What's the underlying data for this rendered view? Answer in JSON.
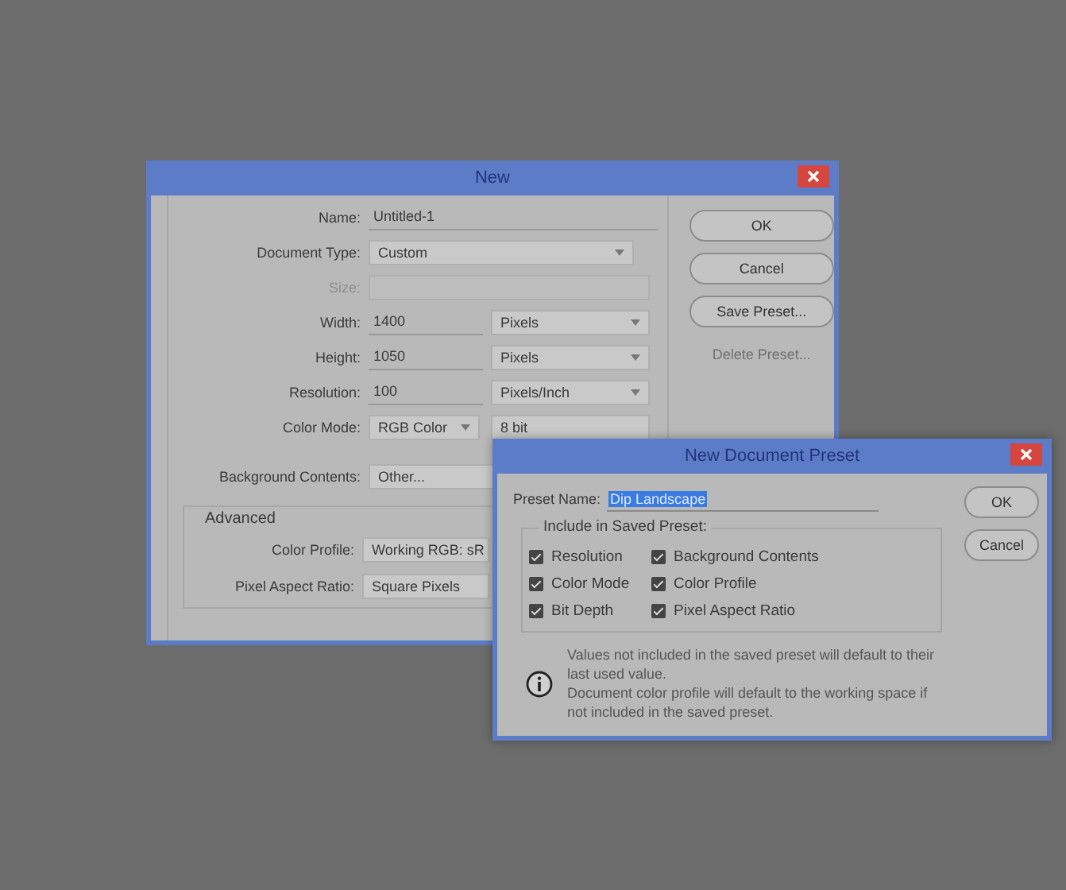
{
  "new_dialog": {
    "title": "New",
    "fields": [
      {
        "kind": "text",
        "label": "Name:",
        "value": "Untitled-1",
        "disabled": false
      },
      {
        "kind": "select",
        "label": "Document Type:",
        "value": "Custom",
        "disabled": false
      },
      {
        "kind": "select",
        "label": "Size:",
        "disabled": true
      },
      {
        "kind": "unit",
        "label": "Width:",
        "value": "1400",
        "unit": "Pixels",
        "disabled": false
      },
      {
        "kind": "unit",
        "label": "Height:",
        "value": "1050",
        "unit": "Pixels",
        "disabled": false
      },
      {
        "kind": "unit",
        "label": "Resolution:",
        "value": "100",
        "unit": "Pixels/Inch",
        "disabled": false
      },
      {
        "kind": "pair",
        "label": "Color Mode:",
        "value": "RGB Color",
        "unit": "8 bit",
        "disabled": false
      },
      {
        "kind": "select",
        "label": "Background Contents:",
        "value": "Other...",
        "disabled": false
      }
    ],
    "advanced": {
      "title": "Advanced",
      "fields": [
        {
          "kind": "select",
          "label": "Color Profile:",
          "value": "Working RGB: sR",
          "disabled": false
        },
        {
          "kind": "select",
          "label": "Pixel Aspect Ratio:",
          "value": "Square Pixels",
          "disabled": false
        }
      ]
    },
    "buttons": [
      {
        "label": "OK",
        "disabled": false
      },
      {
        "label": "Cancel",
        "disabled": false
      },
      {
        "label": "Save Preset...",
        "disabled": false
      },
      {
        "label": "Delete Preset...",
        "disabled": true
      }
    ]
  },
  "preset_dialog": {
    "title": "New Document Preset",
    "preset_name": {
      "label": "Preset Name:",
      "value": "Dip Landscape",
      "selected": true
    },
    "include": {
      "title": "Include in Saved Preset:",
      "options": [
        {
          "label": "Resolution",
          "checked": true
        },
        {
          "label": "Background Contents",
          "checked": true
        },
        {
          "label": "Color Mode",
          "checked": true
        },
        {
          "label": "Color Profile",
          "checked": true
        },
        {
          "label": "Bit Depth",
          "checked": true
        },
        {
          "label": "Pixel Aspect Ratio",
          "checked": true
        }
      ]
    },
    "info": [
      "Values not included in the saved preset will default to their last used value.",
      "Document color profile will default to the working space if not included in the saved preset."
    ],
    "buttons": [
      {
        "label": "OK",
        "disabled": false
      },
      {
        "label": "Cancel",
        "disabled": false
      }
    ]
  }
}
